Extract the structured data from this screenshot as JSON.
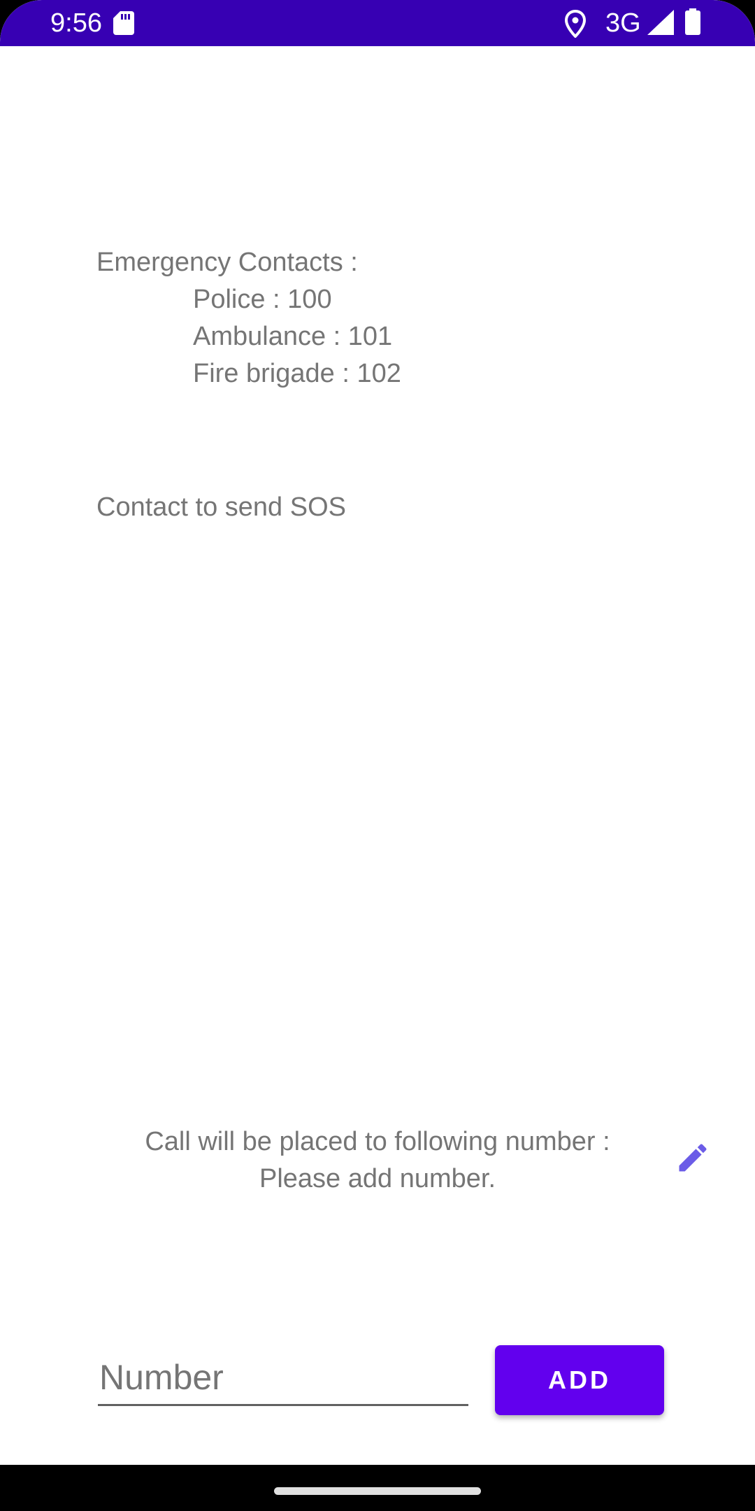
{
  "status_bar": {
    "time": "9:56",
    "network": "3G",
    "icons": [
      "sd-card-icon",
      "location-icon",
      "signal-icon",
      "battery-icon"
    ],
    "background_color": "#3700b3"
  },
  "emergency": {
    "heading": "Emergency Contacts :",
    "contacts": [
      "Police : 100",
      "Ambulance : 101",
      "Fire brigade : 102"
    ]
  },
  "sos": {
    "label": "Contact to send SOS"
  },
  "call": {
    "line1": "Call will be placed to following number :",
    "line2": "Please add number.",
    "edit_icon": "pencil-icon",
    "edit_icon_color": "#6b5ce7"
  },
  "form": {
    "number_placeholder": "Number",
    "number_value": "",
    "add_label": "ADD",
    "add_color": "#6200ee"
  }
}
